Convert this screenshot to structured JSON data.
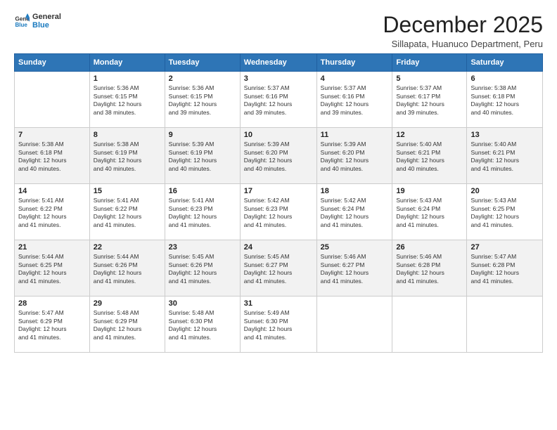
{
  "logo": {
    "line1": "General",
    "line2": "Blue"
  },
  "title": "December 2025",
  "subtitle": "Sillapata, Huanuco Department, Peru",
  "days_header": [
    "Sunday",
    "Monday",
    "Tuesday",
    "Wednesday",
    "Thursday",
    "Friday",
    "Saturday"
  ],
  "weeks": [
    [
      {
        "num": "",
        "info": ""
      },
      {
        "num": "1",
        "info": "Sunrise: 5:36 AM\nSunset: 6:15 PM\nDaylight: 12 hours\nand 38 minutes."
      },
      {
        "num": "2",
        "info": "Sunrise: 5:36 AM\nSunset: 6:15 PM\nDaylight: 12 hours\nand 39 minutes."
      },
      {
        "num": "3",
        "info": "Sunrise: 5:37 AM\nSunset: 6:16 PM\nDaylight: 12 hours\nand 39 minutes."
      },
      {
        "num": "4",
        "info": "Sunrise: 5:37 AM\nSunset: 6:16 PM\nDaylight: 12 hours\nand 39 minutes."
      },
      {
        "num": "5",
        "info": "Sunrise: 5:37 AM\nSunset: 6:17 PM\nDaylight: 12 hours\nand 39 minutes."
      },
      {
        "num": "6",
        "info": "Sunrise: 5:38 AM\nSunset: 6:18 PM\nDaylight: 12 hours\nand 40 minutes."
      }
    ],
    [
      {
        "num": "7",
        "info": "Sunrise: 5:38 AM\nSunset: 6:18 PM\nDaylight: 12 hours\nand 40 minutes."
      },
      {
        "num": "8",
        "info": "Sunrise: 5:38 AM\nSunset: 6:19 PM\nDaylight: 12 hours\nand 40 minutes."
      },
      {
        "num": "9",
        "info": "Sunrise: 5:39 AM\nSunset: 6:19 PM\nDaylight: 12 hours\nand 40 minutes."
      },
      {
        "num": "10",
        "info": "Sunrise: 5:39 AM\nSunset: 6:20 PM\nDaylight: 12 hours\nand 40 minutes."
      },
      {
        "num": "11",
        "info": "Sunrise: 5:39 AM\nSunset: 6:20 PM\nDaylight: 12 hours\nand 40 minutes."
      },
      {
        "num": "12",
        "info": "Sunrise: 5:40 AM\nSunset: 6:21 PM\nDaylight: 12 hours\nand 40 minutes."
      },
      {
        "num": "13",
        "info": "Sunrise: 5:40 AM\nSunset: 6:21 PM\nDaylight: 12 hours\nand 41 minutes."
      }
    ],
    [
      {
        "num": "14",
        "info": "Sunrise: 5:41 AM\nSunset: 6:22 PM\nDaylight: 12 hours\nand 41 minutes."
      },
      {
        "num": "15",
        "info": "Sunrise: 5:41 AM\nSunset: 6:22 PM\nDaylight: 12 hours\nand 41 minutes."
      },
      {
        "num": "16",
        "info": "Sunrise: 5:41 AM\nSunset: 6:23 PM\nDaylight: 12 hours\nand 41 minutes."
      },
      {
        "num": "17",
        "info": "Sunrise: 5:42 AM\nSunset: 6:23 PM\nDaylight: 12 hours\nand 41 minutes."
      },
      {
        "num": "18",
        "info": "Sunrise: 5:42 AM\nSunset: 6:24 PM\nDaylight: 12 hours\nand 41 minutes."
      },
      {
        "num": "19",
        "info": "Sunrise: 5:43 AM\nSunset: 6:24 PM\nDaylight: 12 hours\nand 41 minutes."
      },
      {
        "num": "20",
        "info": "Sunrise: 5:43 AM\nSunset: 6:25 PM\nDaylight: 12 hours\nand 41 minutes."
      }
    ],
    [
      {
        "num": "21",
        "info": "Sunrise: 5:44 AM\nSunset: 6:25 PM\nDaylight: 12 hours\nand 41 minutes."
      },
      {
        "num": "22",
        "info": "Sunrise: 5:44 AM\nSunset: 6:26 PM\nDaylight: 12 hours\nand 41 minutes."
      },
      {
        "num": "23",
        "info": "Sunrise: 5:45 AM\nSunset: 6:26 PM\nDaylight: 12 hours\nand 41 minutes."
      },
      {
        "num": "24",
        "info": "Sunrise: 5:45 AM\nSunset: 6:27 PM\nDaylight: 12 hours\nand 41 minutes."
      },
      {
        "num": "25",
        "info": "Sunrise: 5:46 AM\nSunset: 6:27 PM\nDaylight: 12 hours\nand 41 minutes."
      },
      {
        "num": "26",
        "info": "Sunrise: 5:46 AM\nSunset: 6:28 PM\nDaylight: 12 hours\nand 41 minutes."
      },
      {
        "num": "27",
        "info": "Sunrise: 5:47 AM\nSunset: 6:28 PM\nDaylight: 12 hours\nand 41 minutes."
      }
    ],
    [
      {
        "num": "28",
        "info": "Sunrise: 5:47 AM\nSunset: 6:29 PM\nDaylight: 12 hours\nand 41 minutes."
      },
      {
        "num": "29",
        "info": "Sunrise: 5:48 AM\nSunset: 6:29 PM\nDaylight: 12 hours\nand 41 minutes."
      },
      {
        "num": "30",
        "info": "Sunrise: 5:48 AM\nSunset: 6:30 PM\nDaylight: 12 hours\nand 41 minutes."
      },
      {
        "num": "31",
        "info": "Sunrise: 5:49 AM\nSunset: 6:30 PM\nDaylight: 12 hours\nand 41 minutes."
      },
      {
        "num": "",
        "info": ""
      },
      {
        "num": "",
        "info": ""
      },
      {
        "num": "",
        "info": ""
      }
    ]
  ]
}
